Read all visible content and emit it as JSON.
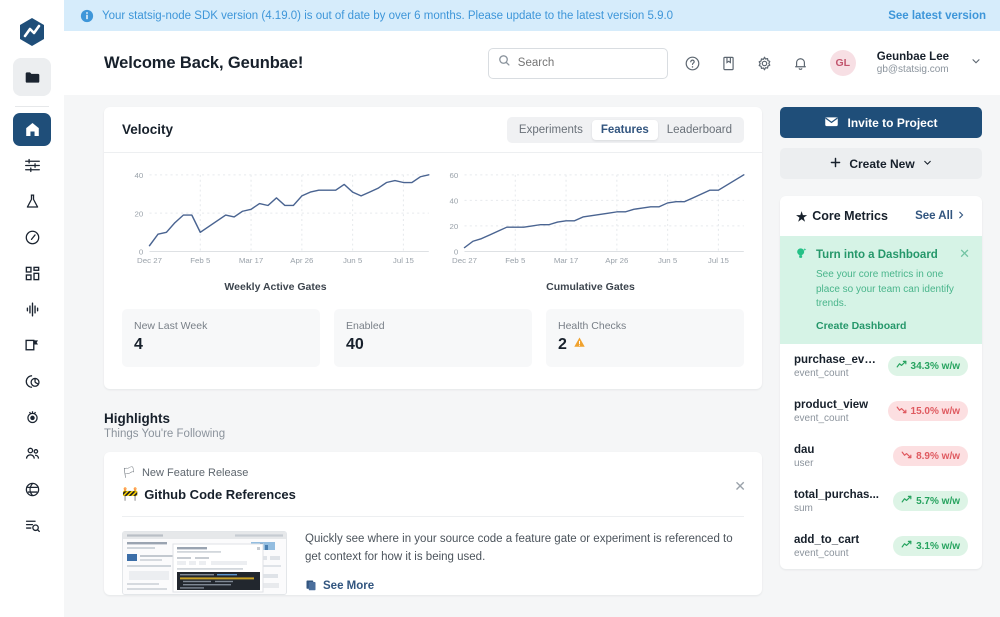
{
  "banner": {
    "icon": "info-circle-icon",
    "message": "Your statsig-node SDK version (4.19.0) is out of date by over 6 months. Please update to the latest version 5.9.0",
    "link": "See latest version",
    "bg_color": "#d6ecfb",
    "text_color": "#3e96d9"
  },
  "rail": {
    "logo": "statsig-hexagon-logo",
    "project_icon": "folder-icon",
    "items": [
      {
        "name": "home",
        "icon": "home-icon",
        "active": true
      },
      {
        "name": "feature-gates",
        "icon": "sliders-icon",
        "active": false
      },
      {
        "name": "experiments",
        "icon": "flask-icon",
        "active": false
      },
      {
        "name": "metrics",
        "icon": "speedometer-icon",
        "active": false
      },
      {
        "name": "dynamic-configs",
        "icon": "grid-blocks-icon",
        "active": false
      },
      {
        "name": "pulse",
        "icon": "waveform-icon",
        "active": false
      },
      {
        "name": "segments",
        "icon": "layout-flag-icon",
        "active": false
      },
      {
        "name": "analytics",
        "icon": "pie-clock-icon",
        "active": false
      },
      {
        "name": "targeting",
        "icon": "target-icon",
        "active": false
      },
      {
        "name": "users",
        "icon": "people-icon",
        "active": false
      },
      {
        "name": "diagnostics",
        "icon": "globe-check-icon",
        "active": false
      },
      {
        "name": "logs",
        "icon": "list-search-icon",
        "active": false
      }
    ]
  },
  "header": {
    "welcome": "Welcome Back, Geunbae!",
    "search": {
      "placeholder": "Search",
      "value": "",
      "icon": "search-icon"
    },
    "icons": [
      {
        "name": "help-icon",
        "glyph": "question-circle"
      },
      {
        "name": "docs-icon",
        "glyph": "book"
      },
      {
        "name": "settings-icon",
        "glyph": "gear"
      },
      {
        "name": "notifications-icon",
        "glyph": "bell"
      }
    ],
    "user": {
      "initials": "GL",
      "name": "Geunbae Lee",
      "email": "gb@statsig.com",
      "caret": "chevron-down-icon"
    }
  },
  "velocity": {
    "title": "Velocity",
    "tabs": [
      {
        "label": "Experiments",
        "active": false
      },
      {
        "label": "Features",
        "active": true
      },
      {
        "label": "Leaderboard",
        "active": false
      }
    ],
    "stats": [
      {
        "label": "New Last Week",
        "value": "4",
        "warning": false
      },
      {
        "label": "Enabled",
        "value": "40",
        "warning": false
      },
      {
        "label": "Health Checks",
        "value": "2",
        "warning": true,
        "warning_icon": "warning-triangle-icon"
      }
    ]
  },
  "chart_data": [
    {
      "type": "line",
      "title": "Weekly Active Gates",
      "xlabel": "",
      "ylabel": "",
      "ylim": [
        0,
        40
      ],
      "yticks": [
        0,
        20,
        40
      ],
      "grid": true,
      "legend": "none",
      "line_color": "#4a6491",
      "xticklabels": [
        "Dec 27",
        "Feb 5",
        "Mar 17",
        "Apr 26",
        "Jun 5",
        "Jul 15"
      ],
      "x": [
        "Dec 27",
        "Jan 3",
        "Jan 10",
        "Jan 17",
        "Jan 24",
        "Jan 31",
        "Feb 5",
        "Feb 12",
        "Feb 19",
        "Feb 26",
        "Mar 5",
        "Mar 12",
        "Mar 17",
        "Mar 24",
        "Mar 31",
        "Apr 7",
        "Apr 14",
        "Apr 21",
        "Apr 26",
        "May 3",
        "May 10",
        "May 17",
        "May 24",
        "May 31",
        "Jun 5",
        "Jun 12",
        "Jun 19",
        "Jun 26",
        "Jul 3",
        "Jul 10",
        "Jul 15",
        "Jul 22",
        "Jul 29",
        "Aug 5"
      ],
      "values": [
        3,
        9,
        10,
        15,
        19,
        19,
        10,
        13,
        16,
        19,
        18,
        21,
        22,
        25,
        24,
        28,
        24,
        24,
        29,
        31,
        32,
        32,
        32,
        35,
        31,
        29,
        31,
        33,
        36,
        37,
        36,
        36,
        39,
        40
      ]
    },
    {
      "type": "line",
      "title": "Cumulative Gates",
      "xlabel": "",
      "ylabel": "",
      "ylim": [
        0,
        60
      ],
      "yticks": [
        0,
        20,
        40,
        60
      ],
      "grid": true,
      "legend": "none",
      "line_color": "#4a6491",
      "xticklabels": [
        "Dec 27",
        "Feb 5",
        "Mar 17",
        "Apr 26",
        "Jun 5",
        "Jul 15"
      ],
      "x": [
        "Dec 27",
        "Jan 3",
        "Jan 10",
        "Jan 17",
        "Jan 24",
        "Jan 31",
        "Feb 5",
        "Feb 12",
        "Feb 19",
        "Feb 26",
        "Mar 5",
        "Mar 12",
        "Mar 17",
        "Mar 24",
        "Mar 31",
        "Apr 7",
        "Apr 14",
        "Apr 21",
        "Apr 26",
        "May 3",
        "May 10",
        "May 17",
        "May 24",
        "May 31",
        "Jun 5",
        "Jun 12",
        "Jun 19",
        "Jun 26",
        "Jul 3",
        "Jul 10",
        "Jul 15",
        "Jul 22",
        "Jul 29",
        "Aug 5"
      ],
      "values": [
        3,
        8,
        10,
        13,
        16,
        19,
        19,
        19,
        20,
        21,
        21,
        23,
        24,
        24,
        27,
        28,
        29,
        30,
        31,
        31,
        33,
        34,
        35,
        35,
        38,
        39,
        39,
        42,
        45,
        48,
        48,
        52,
        56,
        60
      ]
    }
  ],
  "highlights": {
    "title": "Highlights",
    "subtitle": "Things You're Following",
    "card": {
      "kicker_icon": "flag-icon",
      "kicker": "New Feature Release",
      "title_icon": "construction-icon",
      "title": "Github Code References",
      "close_icon": "close-icon",
      "thumbnail": "product-screenshot-thumbnail",
      "description": "Quickly see where in your source code a feature gate or experiment is referenced to get context for how it is being used.",
      "see_more": "See More",
      "see_more_icon": "external-doc-icon"
    }
  },
  "sidebar": {
    "invite": {
      "label": "Invite to Project",
      "icon": "envelope-icon",
      "color": "#1f4e79"
    },
    "create": {
      "label": "Create New",
      "icon": "plus-icon",
      "caret": "chevron-down-icon"
    },
    "core_metrics": {
      "star_icon": "star-icon",
      "title": "Core Metrics",
      "see_all": "See All",
      "see_all_icon": "chevron-right-icon"
    },
    "tip": {
      "icon": "lightbulb-icon",
      "title": "Turn into a Dashboard",
      "body": "See your core metrics in one place so your team can identify trends.",
      "cta": "Create Dashboard",
      "close_icon": "close-icon",
      "bg_color": "#d6f3e6",
      "accent_color": "#25976a"
    },
    "metrics": [
      {
        "name": "purchase_event",
        "type": "event_count",
        "change": "34.3% w/w",
        "direction": "up"
      },
      {
        "name": "product_view",
        "type": "event_count",
        "change": "15.0% w/w",
        "direction": "down"
      },
      {
        "name": "dau",
        "type": "user",
        "change": "8.9% w/w",
        "direction": "down"
      },
      {
        "name": "total_purchas...",
        "type": "sum",
        "change": "5.7% w/w",
        "direction": "up"
      },
      {
        "name": "add_to_cart",
        "type": "event_count",
        "change": "3.1% w/w",
        "direction": "up"
      }
    ]
  }
}
